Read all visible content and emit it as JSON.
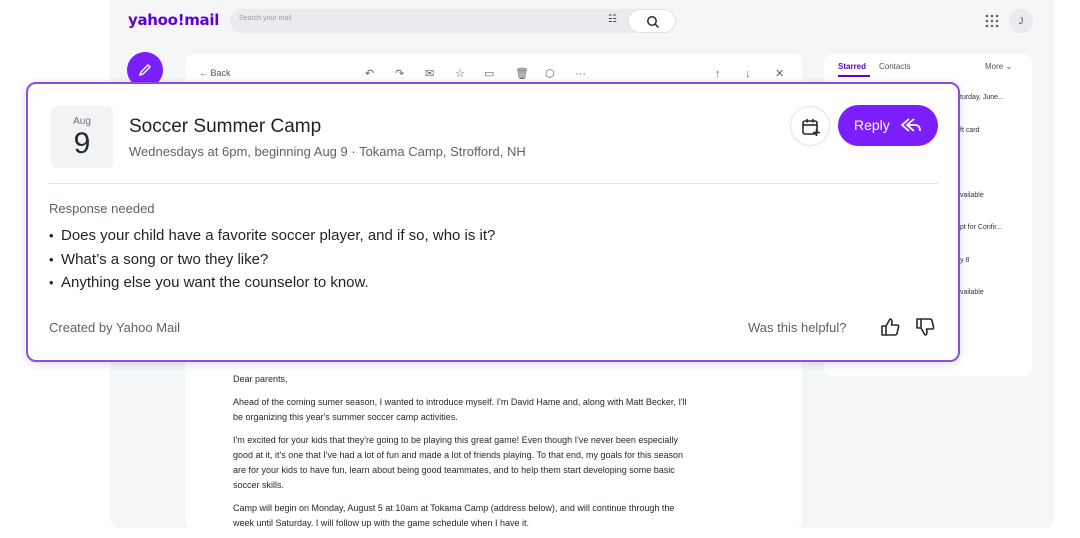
{
  "app": {
    "logo": "yahoo!mail",
    "search_placeholder": "Search your mail",
    "avatar_initial": "J"
  },
  "toolbar": {
    "back_label": "Back"
  },
  "right_panel": {
    "tabs": [
      "Starred",
      "Contacts"
    ],
    "more_label": "More",
    "items": [
      "turday, June...",
      "ft card",
      "vailable",
      "pt for Confir...",
      "y 8",
      "vailable"
    ]
  },
  "event_card": {
    "month": "Aug",
    "day": "9",
    "title": "Soccer Summer Camp",
    "subtitle": "Wednesdays at 6pm, beginning Aug 9 · Tokama Camp, Strofford, NH",
    "reply_label": "Reply",
    "response_label": "Response needed",
    "questions": [
      "Does your child have a favorite soccer player, and if so, who is it?",
      "What’s a song or two they like?",
      "Anything else you want the counselor to know."
    ],
    "created_by": "Created by Yahoo Mail",
    "helpful_prompt": "Was this helpful?"
  },
  "email": {
    "greeting": "Dear parents,",
    "paragraphs": [
      "Ahead of the coming sumer season, I wanted to introduce myself. I'm David Hame and, along with Matt Becker, I'll be organizing this year's summer soccer camp activities.",
      "I'm excited for your kids that they're going to be playing this great game! Even though I've never been especially good at it, it's one that I've had a lot of fun and made a lot of friends playing. To that end, my goals for this season are for your kids to have fun, learn about being good teammates, and to help them start developing some basic soccer skills.",
      "Camp will begin on Monday, August 5 at 10am at Tokama Camp (address below), and will continue through the week until Saturday. I will follow up with the game schedule when I have it."
    ]
  },
  "colors": {
    "brand_purple": "#7b1fff",
    "logo_purple": "#5f01d1",
    "card_border": "#8a4ee0"
  }
}
